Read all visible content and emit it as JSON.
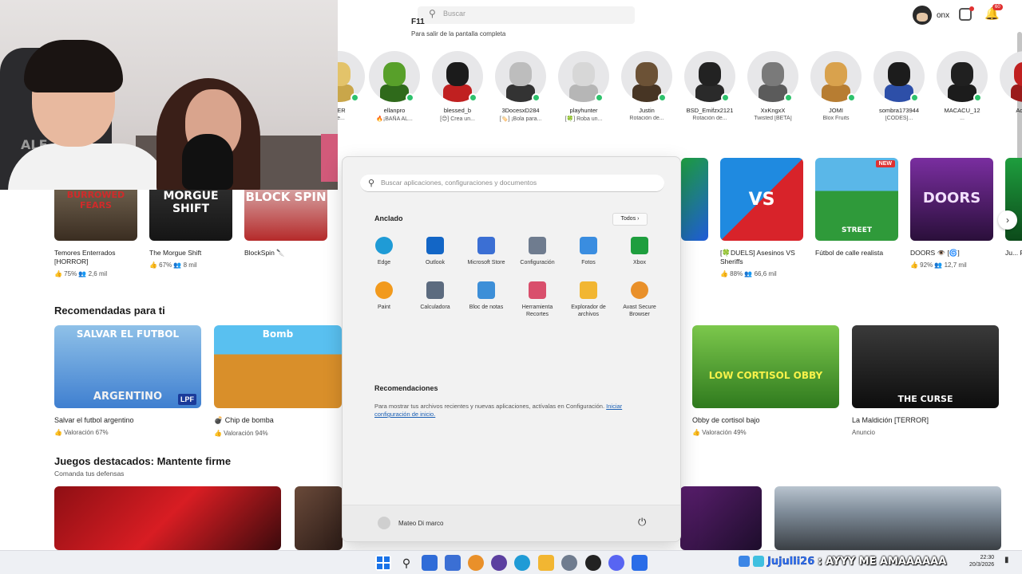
{
  "topbar": {
    "search_placeholder": "Buscar",
    "f11_title": "F11",
    "f11_subtitle": "Para salir de la pantalla completa",
    "username": "onx",
    "notification_count": "60"
  },
  "webcam": {
    "chair_brand": "ALF"
  },
  "friends": [
    {
      "name": "BER",
      "status": "de..."
    },
    {
      "name": "ellanpro",
      "status": "🔥¡BAÑA AL..."
    },
    {
      "name": "blessed_b",
      "status": "[😊] Crea un..."
    },
    {
      "name": "3DocesxD284",
      "status": "[🏷️] ¡Bola para..."
    },
    {
      "name": "playhunter",
      "status": "[🍀] Roba un..."
    },
    {
      "name": "Justin",
      "status": "Rotación de..."
    },
    {
      "name": "BSD_Emifzx2121",
      "status": "Rotación de..."
    },
    {
      "name": "XxKngxX",
      "status": "Twisted [BETA]"
    },
    {
      "name": "JOMI",
      "status": "Blox Fruits"
    },
    {
      "name": "sombra173944",
      "status": "[CODES]..."
    },
    {
      "name": "MACACU_12",
      "status": "..."
    },
    {
      "name": "Admi...",
      "status": ""
    }
  ],
  "top_games": [
    {
      "title": "Temores Enterrados [HORROR]",
      "rating": "75%",
      "players": "2,6 mil",
      "thumb_text": "BURROWED FEARS"
    },
    {
      "title": "The Morgue Shift",
      "rating": "67%",
      "players": "8 mil",
      "thumb_text": "MORGUE SHIFT"
    },
    {
      "title": "BlockSpin 🔪",
      "rating": "",
      "players": "",
      "thumb_text": "BLOCK SPIN"
    },
    {
      "title": "[🍀DUELS] Asesinos VS Sheriffs",
      "rating": "88%",
      "players": "66,6 mil",
      "thumb_text": "VS"
    },
    {
      "title": "Fútbol de calle realista",
      "rating": "",
      "players": "",
      "thumb_text": "STREET",
      "badge": "NEW"
    },
    {
      "title": "DOORS 👁️ [🌀]",
      "rating": "92%",
      "players": "12,7 mil",
      "thumb_text": "DOORS"
    },
    {
      "title": "Ju... Fie...",
      "rating": "",
      "players": "",
      "thumb_text": ""
    }
  ],
  "recommended": {
    "title": "Recomendadas para ti",
    "items": [
      {
        "title": "Salvar el futbol argentino",
        "stat": "Valoración 67%",
        "thumb_text": "SALVAR EL FUTBOL",
        "thumb_sub": "ARGENTINO",
        "thumb_tag": "LPF"
      },
      {
        "title": "💣 Chip de bomba",
        "stat": "Valoración 94%",
        "thumb_text": "Bomb"
      },
      {
        "title": "Obby de cortisol bajo",
        "stat": "Valoración 49%",
        "thumb_text": "LOW CORTISOL OBBY"
      },
      {
        "title": "La Maldición [TERROR]",
        "stat": "Anuncio",
        "thumb_text": "THE CURSE"
      }
    ]
  },
  "featured": {
    "title": "Juegos destacados: Mantente firme",
    "subtitle": "Comanda tus defensas"
  },
  "start_menu": {
    "search_placeholder": "Buscar aplicaciones, configuraciones y documentos",
    "pinned_title": "Anclado",
    "all_label": "Todos",
    "apps": [
      {
        "label": "Edge",
        "color": "#1f9bd6"
      },
      {
        "label": "Outlook",
        "color": "#1366c6"
      },
      {
        "label": "Microsoft Store",
        "color": "#3b6fd4"
      },
      {
        "label": "Configuración",
        "color": "#6f7c8f"
      },
      {
        "label": "Fotos",
        "color": "#3a8de0"
      },
      {
        "label": "Xbox",
        "color": "#1e9e3e"
      },
      {
        "label": "Paint",
        "color": "#f29a1d"
      },
      {
        "label": "Calculadora",
        "color": "#5c6b7f"
      },
      {
        "label": "Bloc de notas",
        "color": "#3d8fd8"
      },
      {
        "label": "Herramienta Recortes",
        "color": "#d94f6c"
      },
      {
        "label": "Explorador de archivos",
        "color": "#f2b632"
      },
      {
        "label": "Avast Secure Browser",
        "color": "#e9902a"
      }
    ],
    "recommendations_title": "Recomendaciones",
    "recommendations_text": "Para mostrar tus archivos recientes y nuevas aplicaciones, actívalas en Configuración.",
    "recommendations_link": "Iniciar configuración de inicio.",
    "user_name": "Mateo Di marco"
  },
  "taskbar": {
    "chat_user": "Jujulli26",
    "chat_message": ": AYYY ME AMAAAAAA",
    "time": "22:30",
    "date": "20/3/2026"
  },
  "colors": {
    "online": "#2ec26c",
    "accent": "#1a5fb4",
    "badge": "#e03131"
  }
}
